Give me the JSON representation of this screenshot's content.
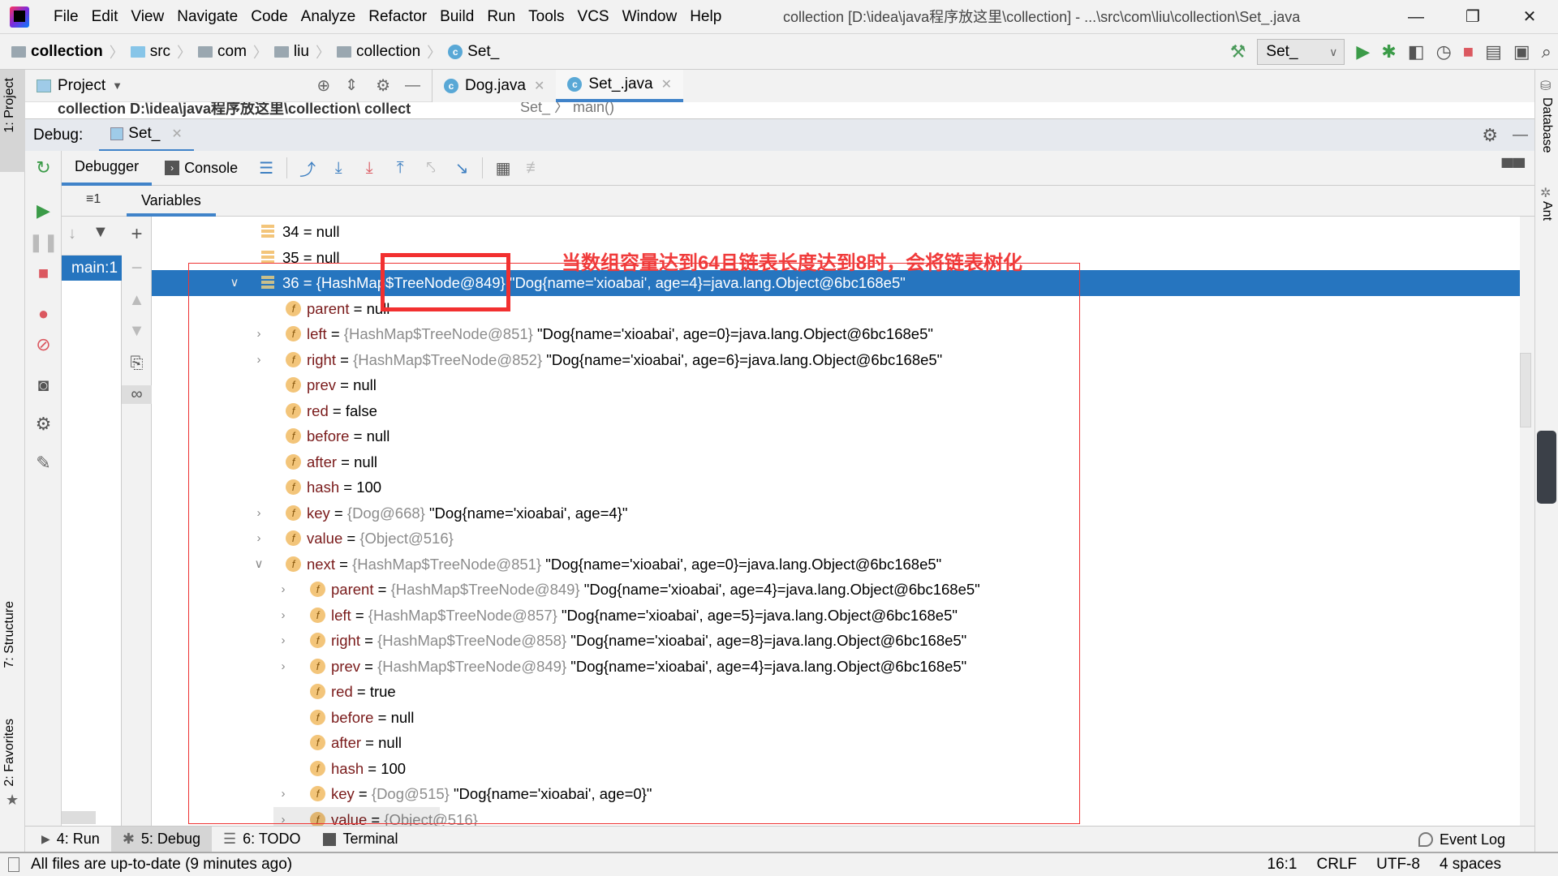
{
  "app": {
    "menu": [
      "File",
      "Edit",
      "View",
      "Navigate",
      "Code",
      "Analyze",
      "Refactor",
      "Build",
      "Run",
      "Tools",
      "VCS",
      "Window",
      "Help"
    ],
    "window_title": "collection [D:\\idea\\java程序放这里\\collection] - ...\\src\\com\\liu\\collection\\Set_.java"
  },
  "breadcrumb": [
    "collection",
    "src",
    "com",
    "liu",
    "collection",
    "Set_"
  ],
  "toolbar": {
    "run_config": "Set_"
  },
  "project_panel": {
    "title": "Project",
    "peek_text": "collection  D:\\idea\\java程序放这里\\collection\\ collect"
  },
  "editor": {
    "tabs": [
      "Dog.java",
      "Set_.java"
    ],
    "active_tab": 1,
    "peek_breadcrumb": "Set_  〉 main()"
  },
  "side_stripes": {
    "left": [
      "1: Project",
      "7: Structure",
      "2: Favorites"
    ],
    "right": [
      "Database",
      "Ant"
    ]
  },
  "debug": {
    "label": "Debug:",
    "session_tab": "Set_",
    "subtabs": [
      "Debugger",
      "Console"
    ],
    "frames_tab_label": "≡1",
    "frame_selected": "main:1",
    "variables_tab": "Variables",
    "annotation": "当数组容量达到64且链表长度达到8时，会将链表树化",
    "rows": [
      {
        "depth": 0,
        "icon": "array",
        "name": "34",
        "ref": "",
        "value": "null",
        "selected": false
      },
      {
        "depth": 0,
        "icon": "array",
        "name": "35",
        "ref": "",
        "value": "null",
        "selected": false
      },
      {
        "depth": 0,
        "icon": "array",
        "name": "36",
        "ref": "{HashMap$TreeNode@849}",
        "value": "\"Dog{name='xioabai', age=4}=java.lang.Object@6bc168e5\"",
        "selected": true,
        "expander": "expanded"
      },
      {
        "depth": 1,
        "icon": "field",
        "name": "parent",
        "ref": "",
        "value": "null"
      },
      {
        "depth": 1,
        "icon": "field",
        "name": "left",
        "ref": "{HashMap$TreeNode@851}",
        "value": "\"Dog{name='xioabai', age=0}=java.lang.Object@6bc168e5\"",
        "expander": "collapsed"
      },
      {
        "depth": 1,
        "icon": "field",
        "name": "right",
        "ref": "{HashMap$TreeNode@852}",
        "value": "\"Dog{name='xioabai', age=6}=java.lang.Object@6bc168e5\"",
        "expander": "collapsed"
      },
      {
        "depth": 1,
        "icon": "field",
        "name": "prev",
        "ref": "",
        "value": "null"
      },
      {
        "depth": 1,
        "icon": "field",
        "name": "red",
        "ref": "",
        "value": "false"
      },
      {
        "depth": 1,
        "icon": "field",
        "name": "before",
        "ref": "",
        "value": "null"
      },
      {
        "depth": 1,
        "icon": "field",
        "name": "after",
        "ref": "",
        "value": "null"
      },
      {
        "depth": 1,
        "icon": "final-field",
        "name": "hash",
        "ref": "",
        "value": "100"
      },
      {
        "depth": 1,
        "icon": "final-field",
        "name": "key",
        "ref": "{Dog@668}",
        "value": "\"Dog{name='xioabai', age=4}\"",
        "expander": "collapsed"
      },
      {
        "depth": 1,
        "icon": "field",
        "name": "value",
        "ref": "{Object@516}",
        "value": "",
        "expander": "collapsed"
      },
      {
        "depth": 1,
        "icon": "field",
        "name": "next",
        "ref": "{HashMap$TreeNode@851}",
        "value": "\"Dog{name='xioabai', age=0}=java.lang.Object@6bc168e5\"",
        "expander": "expanded"
      },
      {
        "depth": 2,
        "icon": "field",
        "name": "parent",
        "ref": "{HashMap$TreeNode@849}",
        "value": "\"Dog{name='xioabai', age=4}=java.lang.Object@6bc168e5\"",
        "expander": "collapsed"
      },
      {
        "depth": 2,
        "icon": "field",
        "name": "left",
        "ref": "{HashMap$TreeNode@857}",
        "value": "\"Dog{name='xioabai', age=5}=java.lang.Object@6bc168e5\"",
        "expander": "collapsed"
      },
      {
        "depth": 2,
        "icon": "field",
        "name": "right",
        "ref": "{HashMap$TreeNode@858}",
        "value": "\"Dog{name='xioabai', age=8}=java.lang.Object@6bc168e5\"",
        "expander": "collapsed"
      },
      {
        "depth": 2,
        "icon": "field",
        "name": "prev",
        "ref": "{HashMap$TreeNode@849}",
        "value": "\"Dog{name='xioabai', age=4}=java.lang.Object@6bc168e5\"",
        "expander": "collapsed"
      },
      {
        "depth": 2,
        "icon": "field",
        "name": "red",
        "ref": "",
        "value": "true"
      },
      {
        "depth": 2,
        "icon": "field",
        "name": "before",
        "ref": "",
        "value": "null"
      },
      {
        "depth": 2,
        "icon": "field",
        "name": "after",
        "ref": "",
        "value": "null"
      },
      {
        "depth": 2,
        "icon": "final-field",
        "name": "hash",
        "ref": "",
        "value": "100"
      },
      {
        "depth": 2,
        "icon": "final-field",
        "name": "key",
        "ref": "{Dog@515}",
        "value": "\"Dog{name='xioabai', age=0}\"",
        "expander": "collapsed"
      },
      {
        "depth": 2,
        "icon": "field",
        "name": "value",
        "ref": "{Object@516}",
        "value": "",
        "expander": "collapsed"
      }
    ]
  },
  "bottom_tabs": [
    {
      "label": "4: Run",
      "icon": "play-icon"
    },
    {
      "label": "5: Debug",
      "icon": "bug-icon",
      "active": true
    },
    {
      "label": "6: TODO",
      "icon": "list-icon"
    },
    {
      "label": "Terminal",
      "icon": "terminal-icon"
    }
  ],
  "event_log": "Event Log",
  "status": {
    "message": "All files are up-to-date (9 minutes ago)",
    "position": "16:1",
    "line_sep": "CRLF",
    "encoding": "UTF-8",
    "indent": "4 spaces"
  },
  "colors": {
    "selection": "#2675bf",
    "accent": "#4083c9",
    "annotation": "#f03b3b",
    "field_name": "#7a1b1b",
    "ref_text": "#8c8c8c"
  }
}
